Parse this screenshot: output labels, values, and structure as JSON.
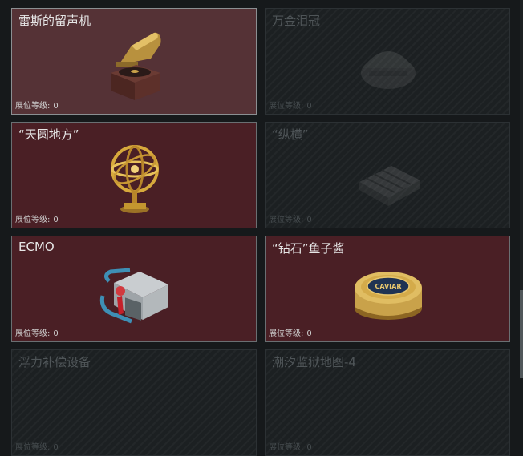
{
  "collections": [
    {
      "title": "雷斯的留声机",
      "level_label": "展位等级:",
      "level": "0",
      "state": "owned-highlight",
      "icon": "gramophone-icon"
    },
    {
      "title": "万金泪冠",
      "level_label": "展位等级:",
      "level": "0",
      "state": "locked",
      "icon": "crown-icon"
    },
    {
      "title": "“天圆地方”",
      "level_label": "展位等级:",
      "level": "0",
      "state": "owned",
      "icon": "armillary-sphere-icon"
    },
    {
      "title": "“纵横”",
      "level_label": "展位等级:",
      "level": "0",
      "state": "locked",
      "icon": "chessboard-icon"
    },
    {
      "title": "ECMO",
      "level_label": "展位等级:",
      "level": "0",
      "state": "owned",
      "icon": "ecmo-machine-icon"
    },
    {
      "title": "“钻石”鱼子酱",
      "level_label": "展位等级:",
      "level": "0",
      "state": "owned",
      "icon": "caviar-tin-icon"
    },
    {
      "title": "浮力补偿设备",
      "level_label": "展位等级:",
      "level": "0",
      "state": "locked",
      "icon": "buoyancy-device-icon"
    },
    {
      "title": "潮汐监狱地图-4",
      "level_label": "展位等级:",
      "level": "0",
      "state": "locked",
      "icon": "map-icon"
    }
  ],
  "caviar_label": "CAVIAR",
  "colors": {
    "owned_bg": "#4a1f25",
    "highlight_bg": "#553236",
    "locked_bg": "#1c2022",
    "gold": "#c9a24a"
  }
}
